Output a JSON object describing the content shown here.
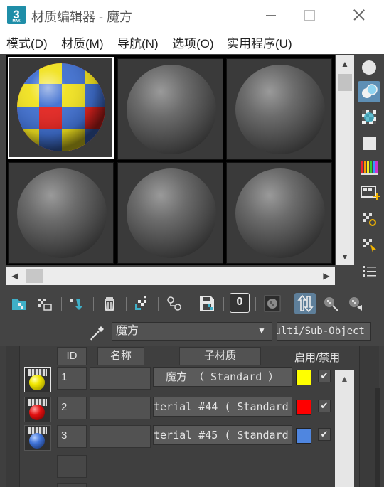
{
  "window": {
    "app_icon_text": "3",
    "app_icon_sub": "MAX",
    "title": "材质编辑器 - 魔方"
  },
  "menu": [
    "模式(D)",
    "材质(M)",
    "导航(N)",
    "选项(O)",
    "实用程序(U)"
  ],
  "material": {
    "name": "魔方",
    "type": "Multi/Sub-Object"
  },
  "sub_materials": {
    "headers": {
      "id": "ID",
      "name": "名称",
      "sub_material": "子材质",
      "enable": "启用/禁用"
    },
    "rows": [
      {
        "id": "1",
        "name": "",
        "material": "魔方 （ Standard ）",
        "color": "#ffff00",
        "enabled": "✔"
      },
      {
        "id": "2",
        "name": "",
        "material": "terial #44  ( Standard",
        "color": "#ff0000",
        "enabled": "✔"
      },
      {
        "id": "3",
        "name": "",
        "material": "terial #45  ( Standard",
        "color": "#4f86e0",
        "enabled": "✔"
      }
    ]
  },
  "material_id_channel": "0",
  "icons": {
    "right_toolbar": [
      "sample-type-sphere-icon",
      "backlight-icon",
      "background-checker-icon",
      "sample-uv-tiling-icon",
      "video-color-check-icon",
      "make-preview-icon",
      "material-options-icon",
      "material-effects-channel-icon",
      "select-by-material-icon"
    ],
    "bottom_toolbar": [
      "get-material-icon",
      "put-to-scene-icon",
      "assign-to-selection-icon",
      "reset-map-icon",
      "make-unique-icon",
      "put-to-library-icon",
      "material-id-channel-icon",
      "show-shaded-icon",
      "show-end-result-icon",
      "go-to-parent-icon",
      "go-forward-to-sibling-icon"
    ]
  }
}
